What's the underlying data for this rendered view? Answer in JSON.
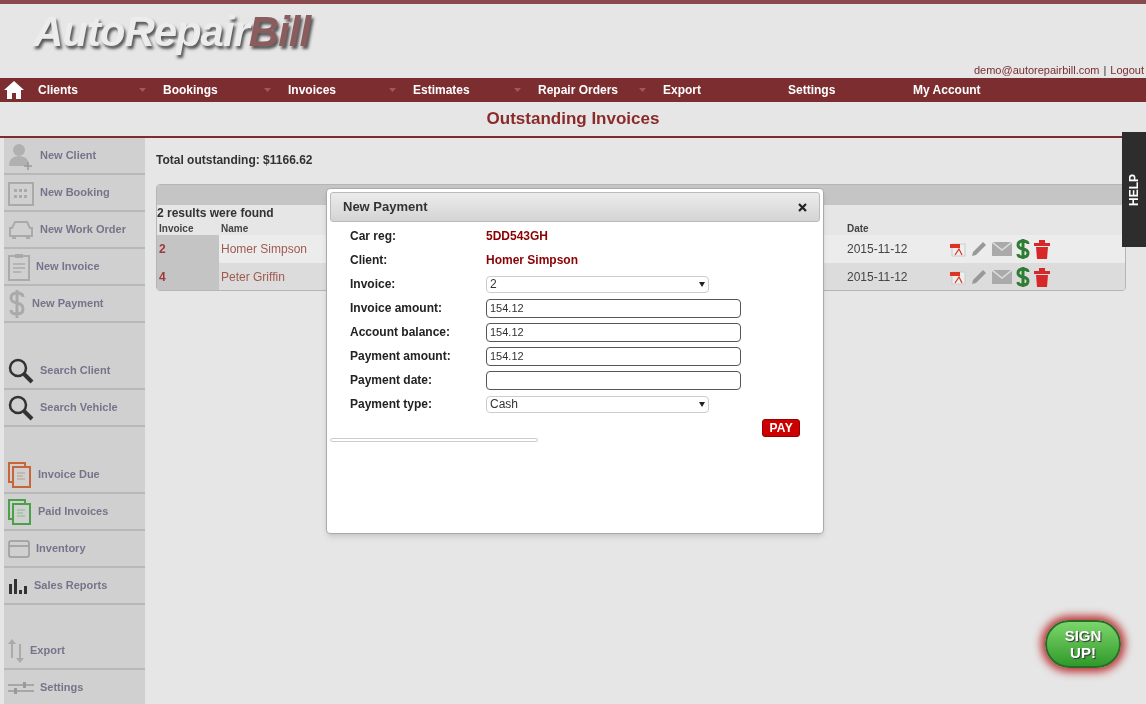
{
  "header": {
    "logo": {
      "part_1": "AutoRepair",
      "part_2": "Bill"
    },
    "user_email": "demo@autorepairbill.com",
    "separator": "|",
    "logout": "Logout"
  },
  "nav": [
    {
      "label": "Clients",
      "dropdown": true
    },
    {
      "label": "Bookings",
      "dropdown": true
    },
    {
      "label": "Invoices",
      "dropdown": true
    },
    {
      "label": "Estimates",
      "dropdown": true
    },
    {
      "label": "Repair Orders",
      "dropdown": true
    },
    {
      "label": "Export",
      "dropdown": false
    },
    {
      "label": "Settings",
      "dropdown": false
    },
    {
      "label": "My Account",
      "dropdown": false
    }
  ],
  "page_title": "Outstanding Invoices",
  "sidebar": {
    "groups": [
      [
        "New Client",
        "New Booking",
        "New Work Order",
        "New Invoice",
        "New Payment"
      ],
      [
        "Search Client",
        "Search Vehicle"
      ],
      [
        "Invoice Due",
        "Paid Invoices",
        "Inventory",
        "Sales Reports"
      ],
      [
        "Export",
        "Settings"
      ]
    ]
  },
  "total_outstanding": "Total outstanding: $1166.62",
  "table": {
    "results_text": "2 results were found",
    "columns": [
      "Invoice",
      "Name",
      "Date"
    ],
    "rows": [
      {
        "invoice": "2",
        "name": "Homer Simpson",
        "date": "2015-11-12"
      },
      {
        "invoice": "4",
        "name": "Peter Griffin",
        "date": "2015-11-12"
      }
    ]
  },
  "modal": {
    "title": "New Payment",
    "info": [
      {
        "label": "Car reg:",
        "value": "5DD543GH"
      },
      {
        "label": "Client:",
        "value": "Homer Simpson"
      }
    ],
    "fields": [
      {
        "label": "Invoice:",
        "kind": "select",
        "value": "2"
      },
      {
        "label": "Invoice amount:",
        "kind": "input",
        "value": "154.12"
      },
      {
        "label": "Account balance:",
        "kind": "input",
        "value": "154.12"
      },
      {
        "label": "Payment amount:",
        "kind": "input",
        "value": "154.12"
      },
      {
        "label": "Payment date:",
        "kind": "input"
      },
      {
        "label": "Payment type:",
        "kind": "select",
        "value": "Cash"
      }
    ],
    "pay_button": "PAY"
  },
  "help_tab": "HELP",
  "signup_button": "SIGN UP!"
}
